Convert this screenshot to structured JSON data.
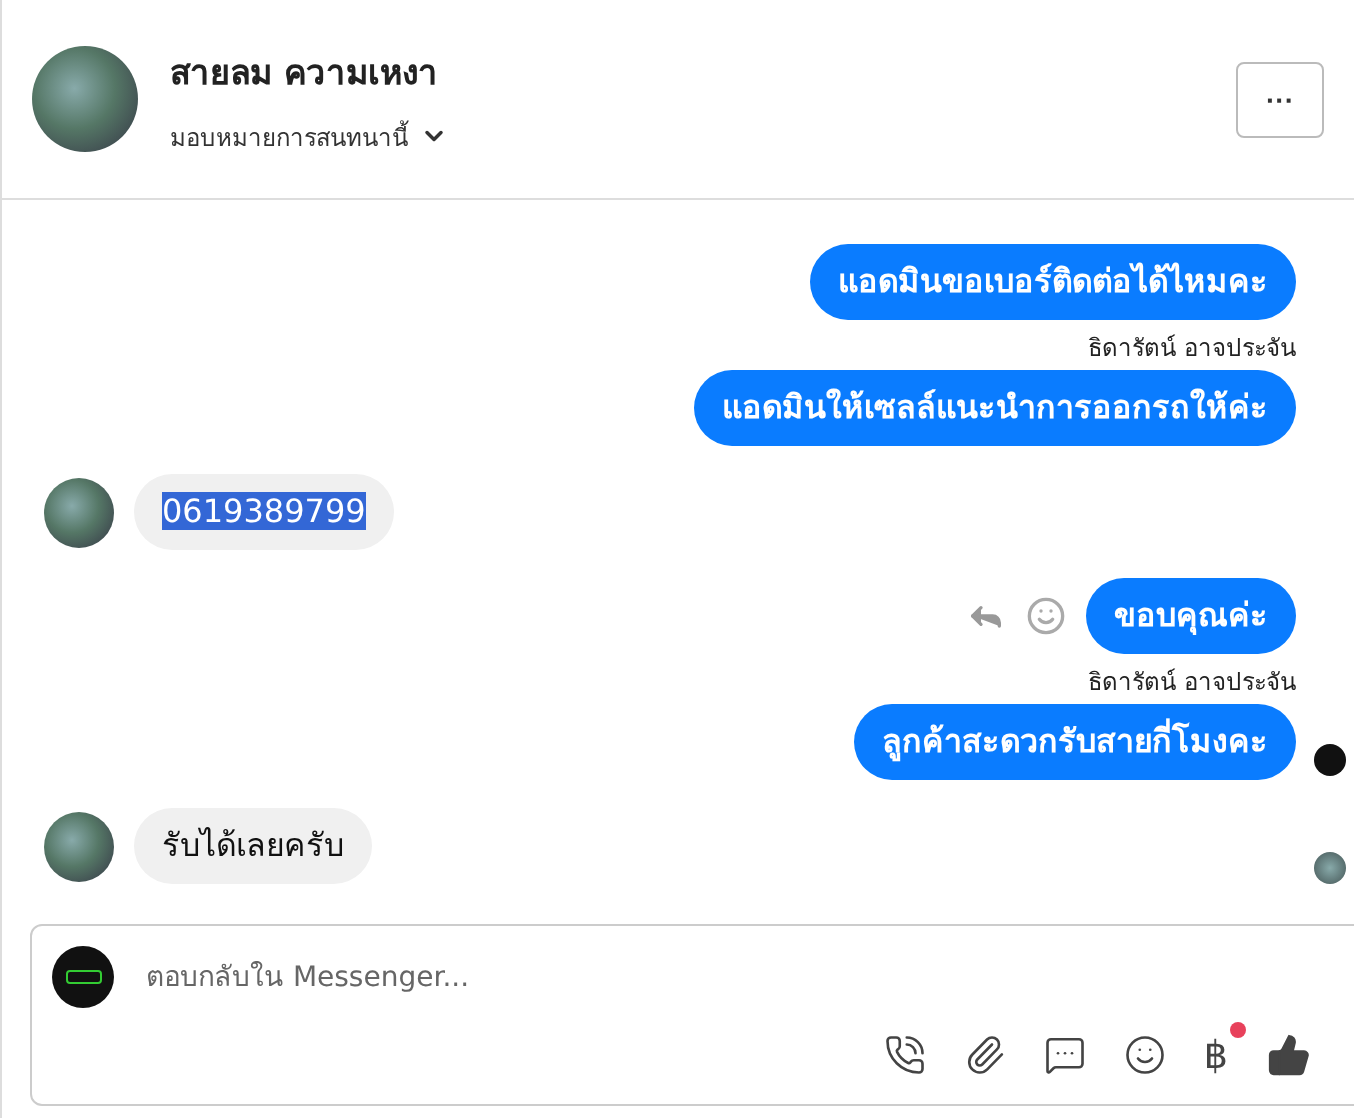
{
  "header": {
    "name": "สายลม ความเหงา",
    "assign_label": "มอบหมายการสนทนานี้",
    "more_button": "···"
  },
  "messages": [
    {
      "kind": "outgoing",
      "text": "แอดมินขอเบอร์ติดต่อได้ไหมคะ",
      "show_actions": false,
      "read_receipt": false
    },
    {
      "kind": "sender",
      "text": "ธิดารัตน์ อาจประจัน"
    },
    {
      "kind": "outgoing",
      "text": "แอดมินให้เซลล์แนะนำการออกรถให้ค่ะ",
      "show_actions": false,
      "read_receipt": false
    },
    {
      "kind": "incoming",
      "text": "0619389799",
      "selected": true,
      "read_receipt": false
    },
    {
      "kind": "outgoing",
      "text": "ขอบคุณค่ะ",
      "show_actions": true,
      "read_receipt": false
    },
    {
      "kind": "sender",
      "text": "ธิดารัตน์ อาจประจัน"
    },
    {
      "kind": "outgoing",
      "text": "ลูกค้าสะดวกรับสายกี่โมงคะ",
      "show_actions": false,
      "read_receipt": true
    },
    {
      "kind": "incoming",
      "text": "รับได้เลยครับ",
      "selected": false,
      "read_receipt": true
    }
  ],
  "composer": {
    "placeholder": "ตอบกลับใน Messenger...",
    "currency_symbol": "฿",
    "currency_badge": true
  }
}
